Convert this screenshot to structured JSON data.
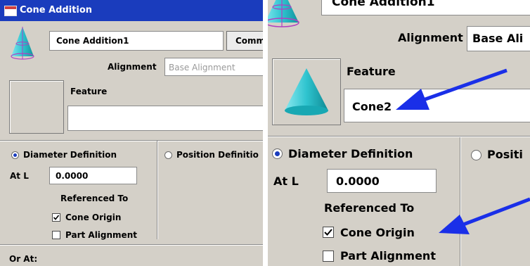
{
  "window": {
    "title": "Cone Addition",
    "icon": "window-icon"
  },
  "feature_name": {
    "value": "Cone Addition1",
    "partial_value": "Cone Addition1"
  },
  "comment_button": {
    "label": "Comm"
  },
  "alignment": {
    "label": "Alignment",
    "value": "Base Alignment",
    "partial_value": "Base Ali"
  },
  "feature": {
    "label": "Feature",
    "left_value": "",
    "right_value": "Cone2"
  },
  "diameter_definition": {
    "label": "Diameter Definition",
    "selected": true
  },
  "position_definition": {
    "label": "Position Definitio",
    "partial_label": "Positi",
    "selected": false
  },
  "at_l": {
    "label": "At L",
    "value": "0.0000"
  },
  "referenced_to": {
    "label": "Referenced To"
  },
  "cone_origin": {
    "label": "Cone Origin",
    "checked": true
  },
  "part_alignment": {
    "label": "Part Alignment",
    "checked": false
  },
  "or_at": {
    "label": "Or At:"
  },
  "icons": {
    "cone_small": "cone-icon",
    "cone_large": "cone-icon",
    "arrow": "arrow-icon",
    "check": "checkmark-icon"
  },
  "colors": {
    "titlebar": "#1a3cbd",
    "panel": "#d4d0c8",
    "cone": "#2fc4cf",
    "cone_outline": "#b040c0",
    "arrow": "#1a2fe8"
  }
}
